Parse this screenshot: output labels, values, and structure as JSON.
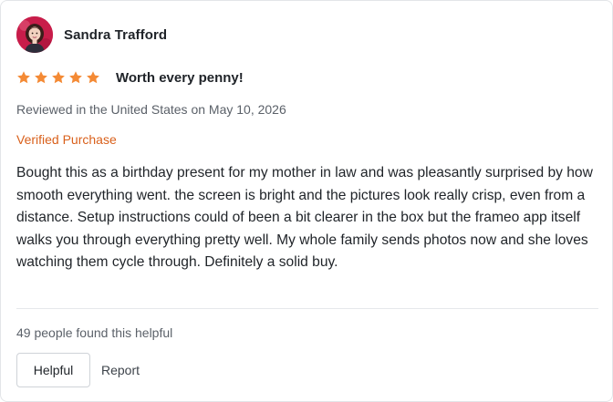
{
  "reviewer": {
    "name": "Sandra Trafford",
    "avatar_icon": "user-avatar-photo"
  },
  "review": {
    "rating": 5,
    "rating_max": 5,
    "star_color": "#f48a35",
    "title": "Worth every penny!",
    "date_line": "Reviewed in the United States on May 10, 2026",
    "verified_label": "Verified Purchase",
    "verified_color": "#d9601b",
    "body": "Bought this as a birthday present for my mother in law and was pleasantly surprised by how smooth everything went. the screen is bright and the pictures look really crisp, even from a distance. Setup instructions could of been a bit clearer in the box but the frameo app itself walks you through everything pretty well. My whole family sends photos now and she loves watching them cycle through. Definitely a solid buy."
  },
  "footer": {
    "helpful_count_text": "49 people found this helpful",
    "helpful_button_label": "Helpful",
    "report_link_label": "Report"
  }
}
